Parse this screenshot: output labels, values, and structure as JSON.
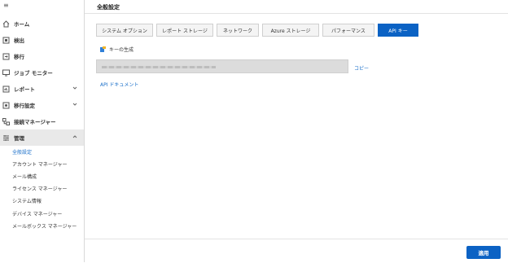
{
  "sidebar": {
    "menu_icon": "hamburger-icon",
    "items": [
      {
        "label": "ホーム",
        "icon": "home-icon"
      },
      {
        "label": "検出",
        "icon": "discover-icon"
      },
      {
        "label": "移行",
        "icon": "migrate-icon"
      },
      {
        "label": "ジョブ モニター",
        "icon": "monitor-icon"
      },
      {
        "label": "レポート",
        "icon": "report-icon",
        "expandable": true
      },
      {
        "label": "移行設定",
        "icon": "migration-settings-icon",
        "expandable": true
      },
      {
        "label": "接続マネージャー",
        "icon": "connection-icon"
      },
      {
        "label": "管理",
        "icon": "admin-icon",
        "expanded": true
      }
    ],
    "sub_items": [
      "全般設定",
      "アカウント マネージャー",
      "メール構成",
      "ライセンス マネージャー",
      "システム情報",
      "デバイス マネージャー",
      "メールボックス マネージャー"
    ],
    "selected_sub_item": "全般設定"
  },
  "main": {
    "title": "全般設定",
    "tabs": [
      {
        "label": "システム オプション"
      },
      {
        "label": "レポート ストレージ"
      },
      {
        "label": "ネットワーク"
      },
      {
        "label": "Azure ストレージ"
      },
      {
        "label": "パフォーマンス"
      },
      {
        "label": "API キー",
        "active": true
      }
    ],
    "key_generate_label": "キーの生成",
    "copy_label": "コピー",
    "api_doc_label": "API ドキュメント",
    "apply_label": "適用"
  },
  "colors": {
    "accent": "#0b62c4",
    "link": "#1a6fc9",
    "active_nav_bg": "#e9e9e9"
  }
}
